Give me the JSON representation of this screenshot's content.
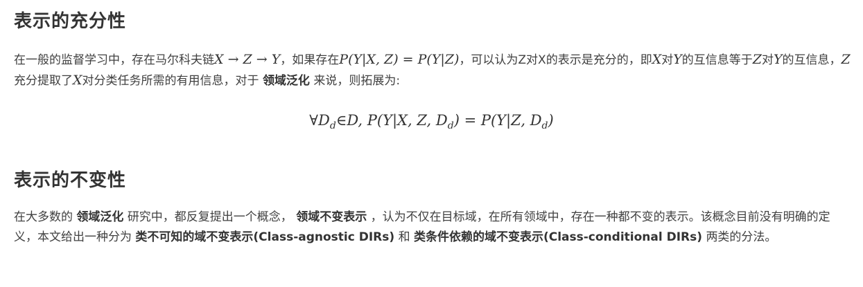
{
  "section1": {
    "title": "表示的充分性",
    "t1": "在一般的监督学习中，存在马尔科夫链",
    "m_chain": "X → Z → Y",
    "t2": "，如果存在",
    "m_cond": "P(Y|X, Z) = P(Y|Z)",
    "t3": "，可以认为Z对X的表示是充分的，即",
    "m_x": "X",
    "t4": "对",
    "m_y": "Y",
    "t5": "的互信息等于",
    "m_z": "Z",
    "t6": "对",
    "m_y2": "Y",
    "t7": "的互信息，",
    "m_z2": "Z",
    "t8": "充分提取了",
    "m_x2": "X",
    "t9": "对分类任务所需的有用信息，对于",
    "bold1": "领域泛化",
    "t10": "来说，则拓展为:",
    "display_formula": "∀D_d∈D, P(Y|X, Z, D_d) = P(Y|Z, D_d)"
  },
  "section2": {
    "title": "表示的不变性",
    "t1": "在大多数的",
    "bold1": "领域泛化",
    "t2": "研究中，都反复提出一个概念，",
    "bold2": "领域不变表示",
    "t3": "，认为不仅在目标域，在所有领域中，存在一种都不变的表示。该概念目前没有明确的定义，本文给出一种分为",
    "bold3": "类不可知的域不变表示(Class-agnostic DIRs)",
    "t4": "和",
    "bold4": "类条件依赖的域不变表示(Class-conditional DIRs)",
    "t5": "两类的分法。"
  }
}
